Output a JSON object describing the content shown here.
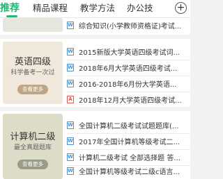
{
  "tabs": [
    {
      "label": "推荐",
      "active": true
    },
    {
      "label": "精品课程",
      "active": false
    },
    {
      "label": "教学方法",
      "active": false
    },
    {
      "label": "办公技",
      "active": false
    }
  ],
  "plus_symbol": "+",
  "top_partial": {
    "title": "综合知识(小学教师资格证)考试...",
    "icon_type": "word"
  },
  "sections": [
    {
      "banner": {
        "title": "英语四级",
        "subtitle": "科学备考一次过",
        "button": "查看更多",
        "bg": "#f1e8dc",
        "button_color": "#bfa587"
      },
      "docs": [
        {
          "title": "2015新版大学英语四级考试词...",
          "icon_type": "word"
        },
        {
          "title": "2018年6月大学英语四级考试...",
          "icon_type": "word"
        },
        {
          "title": "2016-2018年6月份大学英语...",
          "icon_type": "word"
        },
        {
          "title": "2018年12月大学英语四级考试...",
          "icon_type": "pdf"
        }
      ]
    },
    {
      "banner": {
        "title": "计算机二级",
        "subtitle": "最全真题题库",
        "button": "查看更多",
        "bg": "#dcdcc8",
        "button_color": "#9a9c8a"
      },
      "docs": [
        {
          "title": "全国计算机二级考试试题题库(...",
          "icon_type": "word"
        },
        {
          "title": "2017年全国计算机等级考试二...",
          "icon_type": "word"
        },
        {
          "title": "计算机二级考试 全部选择题 答...",
          "icon_type": "word"
        },
        {
          "title": "全国计算机等级考试二级c语言...",
          "icon_type": "word"
        }
      ]
    }
  ],
  "icon_glyphs": {
    "word": "W",
    "pdf": "A"
  },
  "colors": {
    "accent": "#22b573",
    "word_icon": "#4a90d9",
    "pdf_icon": "#e0504a"
  }
}
